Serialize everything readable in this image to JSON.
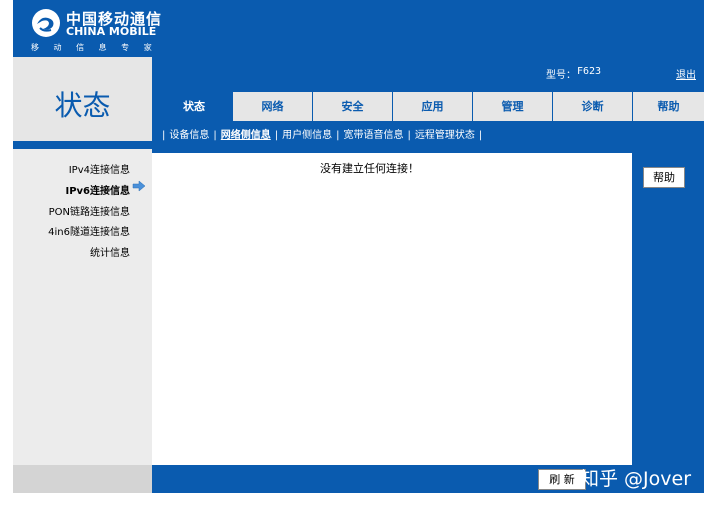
{
  "brand": {
    "name_cn": "中国移动通信",
    "name_en": "CHINA MOBILE",
    "slogan": "移 动 信 息 专 家"
  },
  "page_title": "状态",
  "device": {
    "model_label": "型号：",
    "model_value": "F623",
    "logout_label": "退出"
  },
  "tabs": [
    {
      "label": "状态",
      "active": true
    },
    {
      "label": "网络",
      "active": false
    },
    {
      "label": "安全",
      "active": false
    },
    {
      "label": "应用",
      "active": false
    },
    {
      "label": "管理",
      "active": false
    },
    {
      "label": "诊断",
      "active": false
    },
    {
      "label": "帮助",
      "active": false
    }
  ],
  "subnav": [
    {
      "label": "设备信息"
    },
    {
      "label": "网络侧信息",
      "current": true
    },
    {
      "label": "用户侧信息"
    },
    {
      "label": "宽带语音信息"
    },
    {
      "label": "远程管理状态"
    }
  ],
  "sidebar": {
    "items": [
      {
        "label": "IPv4连接信息"
      },
      {
        "label": "IPv6连接信息",
        "current": true
      },
      {
        "label": "PON链路连接信息"
      },
      {
        "label": "4in6隧道连接信息"
      },
      {
        "label": "统计信息"
      }
    ]
  },
  "main": {
    "message": "没有建立任何连接！"
  },
  "help_button": "帮助",
  "refresh_button": "刷 新",
  "watermark": "知乎 @Jover",
  "colors": {
    "brand_blue": "#0A5BAF",
    "panel_gray": "#E6E6E6"
  }
}
